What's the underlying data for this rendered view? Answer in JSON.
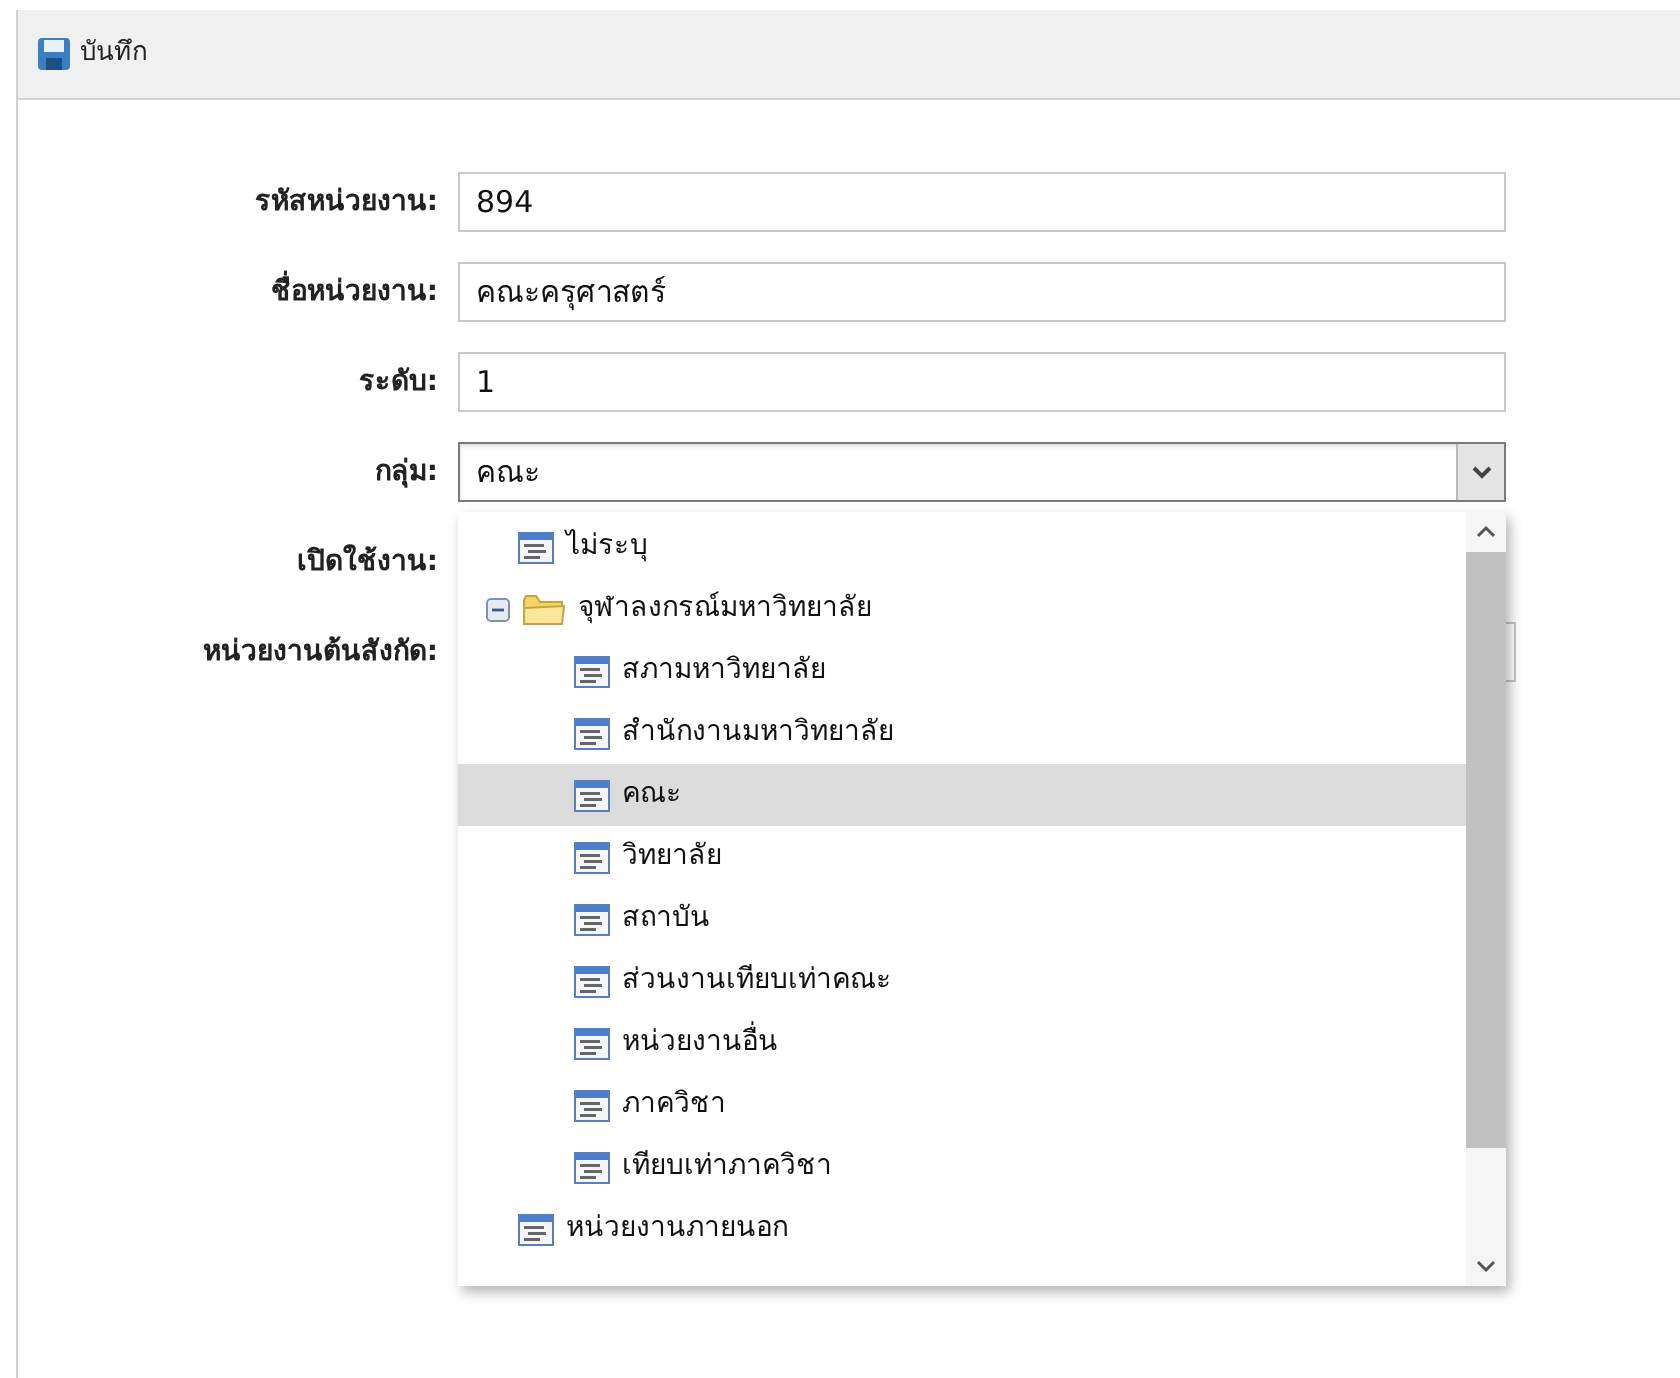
{
  "toolbar": {
    "save_button": "บันทึก"
  },
  "fields": [
    {
      "label": "รหัสหน่วยงาน:",
      "kind": "text",
      "value": "894"
    },
    {
      "label": "ชื่อหน่วยงาน:",
      "kind": "text",
      "value": "คณะครุศาสตร์"
    },
    {
      "label": "ระดับ:",
      "kind": "text",
      "value": "1"
    },
    {
      "label": "กลุ่ม:",
      "kind": "combo",
      "value": "คณะ",
      "expanded": true
    },
    {
      "label": "เปิดใช้งาน:",
      "kind": "hidden"
    },
    {
      "label": "หน่วยงานต้นสังกัด:",
      "kind": "text"
    }
  ],
  "dropdown": {
    "items": [
      {
        "label": "ไม่ระบุ",
        "kind": "leaf",
        "selected": false
      },
      {
        "label": "จุฬาลงกรณ์มหาวิทยาลัย",
        "kind": "folder",
        "expanded": true,
        "selected": false,
        "children": [
          {
            "label": "สภามหาวิทยาลัย",
            "kind": "leaf",
            "selected": false
          },
          {
            "label": "สำนักงานมหาวิทยาลัย",
            "kind": "leaf",
            "selected": false
          },
          {
            "label": "คณะ",
            "kind": "leaf",
            "selected": true
          },
          {
            "label": "วิทยาลัย",
            "kind": "leaf",
            "selected": false
          },
          {
            "label": "สถาบัน",
            "kind": "leaf",
            "selected": false
          },
          {
            "label": "ส่วนงานเทียบเท่าคณะ",
            "kind": "leaf",
            "selected": false
          },
          {
            "label": "หน่วยงานอื่น",
            "kind": "leaf",
            "selected": false
          },
          {
            "label": "ภาควิชา",
            "kind": "leaf",
            "selected": false
          },
          {
            "label": "เทียบเท่าภาควิชา",
            "kind": "leaf",
            "selected": false
          }
        ]
      },
      {
        "label": "หน่วยงานภายนอก",
        "kind": "leaf",
        "selected": false
      }
    ]
  }
}
